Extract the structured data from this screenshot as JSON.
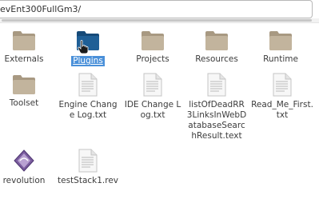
{
  "path": {
    "text": "evEnt300FullGm3/"
  },
  "files": [
    {
      "name": "Externals",
      "type": "folder"
    },
    {
      "name": "Plugins",
      "type": "folder",
      "selected": true
    },
    {
      "name": "Projects",
      "type": "folder"
    },
    {
      "name": "Resources",
      "type": "folder"
    },
    {
      "name": "Runtime",
      "type": "folder"
    },
    {
      "name": "Toolset",
      "type": "folder"
    },
    {
      "name": "Engine Change Log.txt",
      "type": "text"
    },
    {
      "name": "IDE Change Log.txt",
      "type": "text"
    },
    {
      "name": "listOfDeadRR3LinksInWebDatabaseSearchResult.text",
      "type": "text"
    },
    {
      "name": "Read_Me_First.txt",
      "type": "text"
    },
    {
      "name": "revolution",
      "type": "app"
    },
    {
      "name": "testStack1.rev",
      "type": "text"
    }
  ],
  "colors": {
    "folder": "#b5a68c",
    "folder_selected": "#1f5f96",
    "selection": "#4a90d9"
  }
}
